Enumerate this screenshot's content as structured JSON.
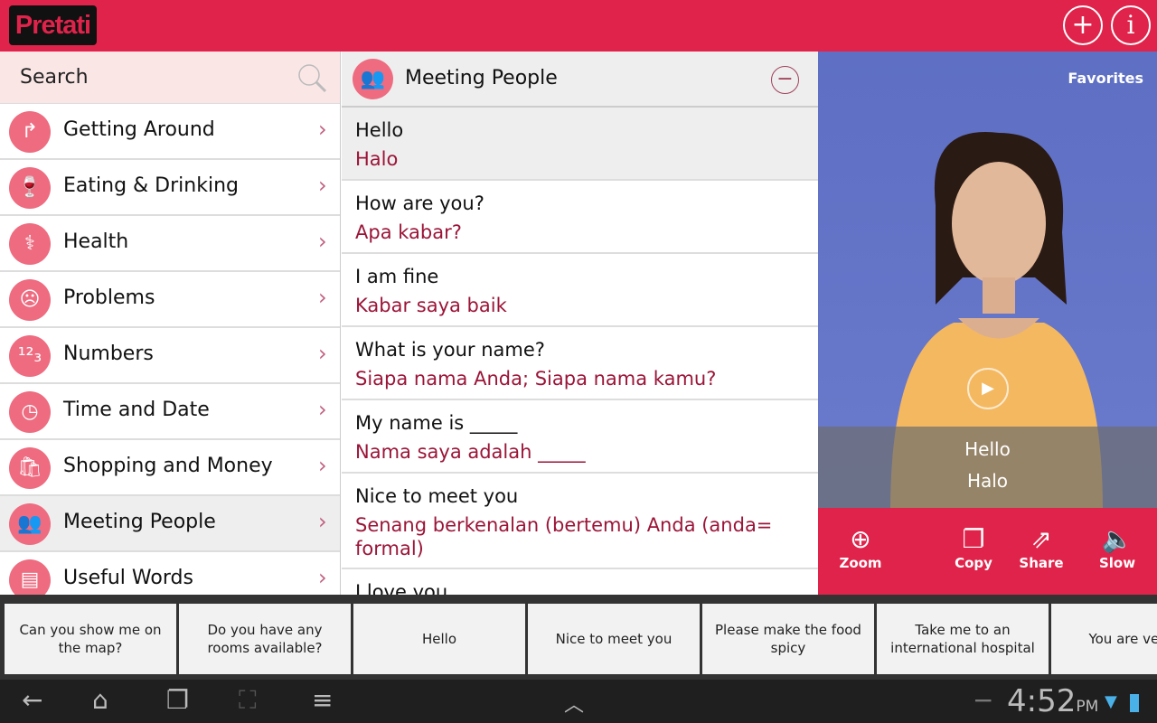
{
  "app": {
    "logo": "Pretati",
    "add_icon": "plus-icon",
    "info_icon": "info-icon"
  },
  "search": {
    "placeholder": "Search"
  },
  "categories": [
    {
      "label": "Getting Around",
      "icon": "turn-right-icon",
      "glyph": "↱"
    },
    {
      "label": "Eating & Drinking",
      "icon": "glass-icon",
      "glyph": "🍷"
    },
    {
      "label": "Health",
      "icon": "stethoscope-icon",
      "glyph": "⚕"
    },
    {
      "label": "Problems",
      "icon": "sad-face-icon",
      "glyph": "☹"
    },
    {
      "label": "Numbers",
      "icon": "numbers-icon",
      "glyph": "¹²₃"
    },
    {
      "label": "Time and Date",
      "icon": "clock-icon",
      "glyph": "◷"
    },
    {
      "label": "Shopping and Money",
      "icon": "shopping-bag-icon",
      "glyph": "🛍"
    },
    {
      "label": "Meeting People",
      "icon": "people-icon",
      "glyph": "👥",
      "selected": true
    },
    {
      "label": "Useful Words",
      "icon": "book-icon",
      "glyph": "▤"
    }
  ],
  "phrases_panel": {
    "title": "Meeting People",
    "collapse_icon": "minus-circle-icon",
    "phrases": [
      {
        "en": "Hello",
        "id": "Halo",
        "selected": true
      },
      {
        "en": "How are you?",
        "id": "Apa kabar?"
      },
      {
        "en": "I am fine",
        "id": "Kabar saya baik"
      },
      {
        "en": "What is your name?",
        "id": "Siapa nama Anda; Siapa nama kamu?"
      },
      {
        "en": "My name is _____",
        "id": "Nama saya adalah _____"
      },
      {
        "en": "Nice to meet you",
        "id": "Senang berkenalan (bertemu) Anda (anda= formal)"
      },
      {
        "en": "I love you",
        "id": ""
      }
    ]
  },
  "video": {
    "favorites": "Favorites",
    "caption_en": "Hello",
    "caption_id": "Halo",
    "play_icon": "play-icon"
  },
  "actions": [
    {
      "label": "Zoom",
      "icon": "zoom-icon"
    },
    {
      "label": "Copy",
      "icon": "copy-icon"
    },
    {
      "label": "Share",
      "icon": "share-icon"
    },
    {
      "label": "Slow",
      "icon": "speaker-icon"
    }
  ],
  "quick_phrases": [
    "Can you show me on the map?",
    "Do you have any rooms available?",
    "Hello",
    "Nice to meet you",
    "Please make the food spicy",
    "Take me to an international hospital",
    "You are very b"
  ],
  "system": {
    "time": "4:52",
    "ampm": "PM"
  },
  "colors": {
    "brand": "#e0234a",
    "translation": "#9b1538",
    "icon_bg": "#ee6b80"
  }
}
